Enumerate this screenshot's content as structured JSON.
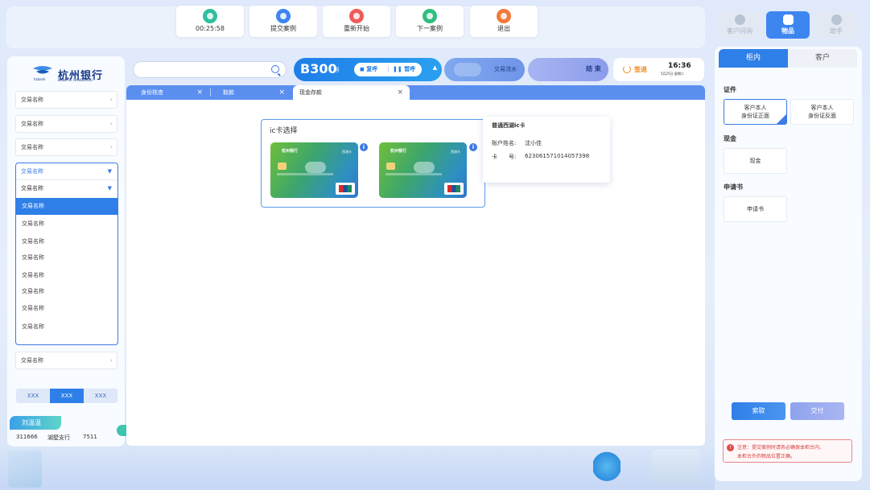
{
  "toolbar": {
    "buttons": [
      {
        "label": "00:25:58",
        "color": "#2fbf9f"
      },
      {
        "label": "提交案例",
        "color": "#3d86f0"
      },
      {
        "label": "重新开始",
        "color": "#ef5b5b"
      },
      {
        "label": "下一案例",
        "color": "#2fbf7f"
      },
      {
        "label": "退出",
        "color": "#f07a3a"
      }
    ]
  },
  "right_top": {
    "customer_chat": "客户问询",
    "items": "物品",
    "assistant": "助手"
  },
  "bank": {
    "name_cn": "杭州银行",
    "name_en": "BANK OF HANGZHOU",
    "short": "hzbank"
  },
  "left": {
    "selects": [
      "交易名称",
      "交易名称",
      "交易名称"
    ],
    "dropdown": {
      "head1": "交易名称",
      "head2": "交易名称",
      "options": [
        "交易名称",
        "交易名称",
        "交易名称",
        "交易名称",
        "交易名称",
        "交易名称",
        "交易名称",
        "交易名称"
      ]
    },
    "select_bottom": "交易名称",
    "segments": [
      "XXX",
      "XXX",
      "XXX"
    ],
    "user": {
      "name": "刘温温",
      "teller_id": "311666",
      "branch": "湖墅支行",
      "code": "7511"
    }
  },
  "header": {
    "search_placeholder": "",
    "queue_number": "B300",
    "queue_suffix": "号",
    "recall": "复呼",
    "pause": "暂呼",
    "flow": "交易流水",
    "end": "结 束",
    "signoff": "签退",
    "time": "16:36",
    "date": "5月25日 星期二"
  },
  "tabs": [
    {
      "label": "身份核查"
    },
    {
      "label": "取款"
    },
    {
      "label": "现金存款"
    }
  ],
  "ic_select": {
    "title": "ic卡选择",
    "card_bank": "杭州银行",
    "card_type": "西湖卡",
    "info": "i"
  },
  "tooltip": {
    "title": "普通西湖ic卡",
    "name_label": "账户姓名:",
    "name_value": "沈小佳",
    "card_label": "卡　　号:",
    "card_value": "6230615710140573​98"
  },
  "right": {
    "tab_counter": "柜内",
    "tab_customer": "客户",
    "sec_id": "证件",
    "id_front": [
      "客户本人",
      "身份证正面"
    ],
    "id_back": [
      "客户本人",
      "身份证反面"
    ],
    "sec_cash": "现金",
    "cash": "现金",
    "sec_form": "申请书",
    "form": "申请书",
    "fetch": "索取",
    "deliver": "交付",
    "note_line1": "注意：提交案例时请务必确保本柜台内、",
    "note_line2": "本柜台外的物品位置正确。"
  },
  "colors": {
    "accent": "#3d7be5",
    "tab_strip": "#5a8ff0",
    "warning": "#d23d3d"
  }
}
